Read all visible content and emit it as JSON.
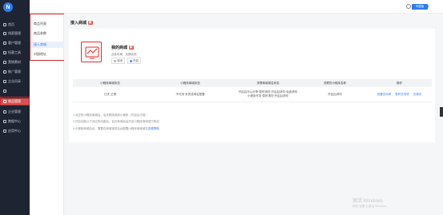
{
  "app": {
    "logo_letter": "N"
  },
  "nav": {
    "items": [
      {
        "label": "首页",
        "icon": "home-icon"
      },
      {
        "label": "线索管理",
        "icon": "clue-icon"
      },
      {
        "label": "客户管理",
        "icon": "customer-icon"
      },
      {
        "label": "拓客工具",
        "icon": "tool-icon"
      },
      {
        "label": "营销素材",
        "icon": "material-icon"
      },
      {
        "label": "推广管理",
        "icon": "promotion-icon"
      },
      {
        "label": "企业风采",
        "icon": "company-icon"
      },
      {
        "label": "商品管理",
        "icon": "product-icon"
      },
      {
        "label": "企业管理",
        "icon": "enterprise-icon"
      },
      {
        "label": "数据中心",
        "icon": "data-icon"
      },
      {
        "label": "应用中心",
        "icon": "app-icon"
      }
    ],
    "active_index": 7
  },
  "subnav": {
    "items": [
      "商品列表",
      "商品参数",
      "接入商城",
      "对接地址"
    ],
    "active_index": 2
  },
  "topbar": {
    "help_icon": "help-icon",
    "user_icon": "user-icon",
    "badge": "专属版"
  },
  "page": {
    "title": "接入商城",
    "title_tag": "新"
  },
  "shop": {
    "name": "我的商城",
    "name_tag": "新",
    "desc": "此处布局，后期实现",
    "options": [
      "关闭",
      "开启"
    ],
    "selected_option": 1
  },
  "table": {
    "headers": [
      "小程序商城状态",
      "小程序商城状态",
      "关联商城域名状态",
      "关联的小程序名称",
      "操作"
    ],
    "row": {
      "c1": "已关·正常",
      "c2": "不可用·未完成域名配置",
      "c3": "开启后可以分享·暂时请勿·开启后请勿·免费请勿小程序开发·暂时请勿·开启后请勿",
      "c4": "开启后请勿",
      "ops": [
        "设置去向项",
        "暂时去向项",
        "去调试"
      ]
    }
  },
  "notes": {
    "line1": "1.对应的小程序商城后，会关联商城到小程序（开启后可用）",
    "line2": "2.开启功能以下对应的功能后，会在商城后台开启小程序商城进行购买",
    "line3": "3.小程序商城后台，需要在商城相关后台配置小程序商城域名",
    "line3_link": "查看帮助"
  },
  "watermark": {
    "line1": "激活 Windows",
    "line2": "转到\"设置\"以激活 Windows。"
  },
  "colors": {
    "sidebar": "#1f2433",
    "accent": "#2d7df0",
    "active": "#d6524e",
    "highlight": "#c5282d"
  }
}
